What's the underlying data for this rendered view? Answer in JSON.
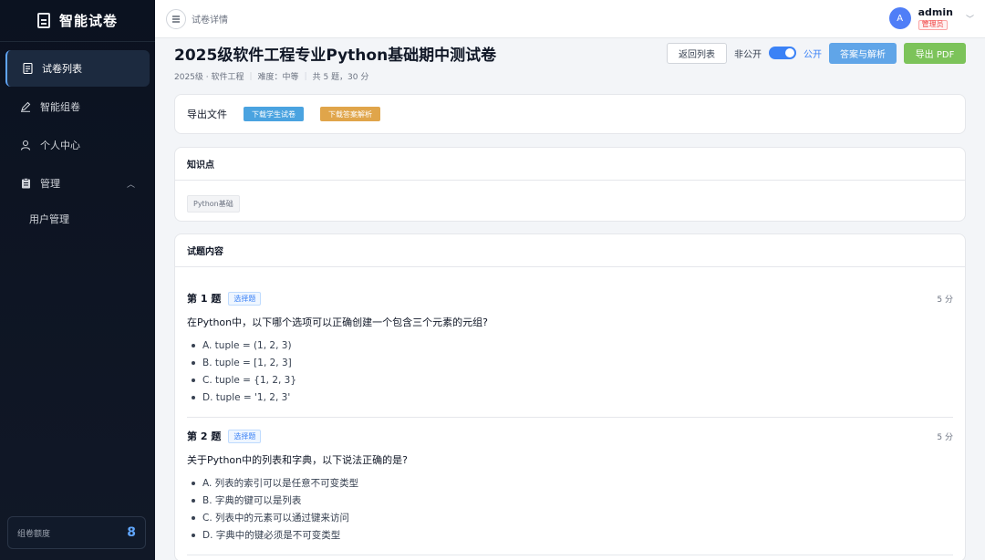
{
  "sidebar": {
    "brand": "智能试卷",
    "items": [
      {
        "label": "试卷列表"
      },
      {
        "label": "智能组卷"
      },
      {
        "label": "个人中心"
      },
      {
        "label": "管理"
      }
    ],
    "sub_items": [
      {
        "label": "用户管理"
      }
    ],
    "quota": {
      "label": "组卷额度",
      "value": "8"
    }
  },
  "topbar": {
    "breadcrumb": "试卷详情",
    "user": {
      "avatar_letter": "A",
      "name": "admin",
      "role": "管理员"
    }
  },
  "header": {
    "title": "2025级软件工程专业Python基础期中测试卷",
    "meta": [
      "2025级 · 软件工程",
      "难度：中等",
      "共 5 题，30 分"
    ],
    "actions": {
      "back": "返回列表",
      "private": "非公开",
      "public": "公开",
      "answers": "答案与解析",
      "export_pdf": "导出 PDF"
    },
    "public_enabled": true
  },
  "export": {
    "label": "导出文件",
    "student_btn": "下载学生试卷",
    "answer_btn": "下载答案解析"
  },
  "knowledge": {
    "title": "知识点",
    "tags": [
      "Python基础"
    ]
  },
  "questions_section": {
    "title": "试题内容",
    "questions": [
      {
        "number": "第 1 题",
        "type": "选择题",
        "score": "5 分",
        "text": "在Python中，以下哪个选项可以正确创建一个包含三个元素的元组?",
        "options": [
          "A. tuple = (1, 2, 3)",
          "B. tuple = [1, 2, 3]",
          "C. tuple = {1, 2, 3}",
          "D. tuple = '1, 2, 3'"
        ]
      },
      {
        "number": "第 2 题",
        "type": "选择题",
        "score": "5 分",
        "text": "关于Python中的列表和字典，以下说法正确的是?",
        "options": [
          "A. 列表的索引可以是任意不可变类型",
          "B. 字典的键可以是列表",
          "C. 列表中的元素可以通过键来访问",
          "D. 字典中的键必须是不可变类型"
        ]
      }
    ]
  },
  "colors": {
    "sidebar_bg": "#0b1220",
    "accent": "#3b82f6",
    "export_pdf": "#7cc35a",
    "answers_btn": "#60a5e8",
    "download_student": "#4aa3e0",
    "download_answer": "#e0a54a"
  }
}
